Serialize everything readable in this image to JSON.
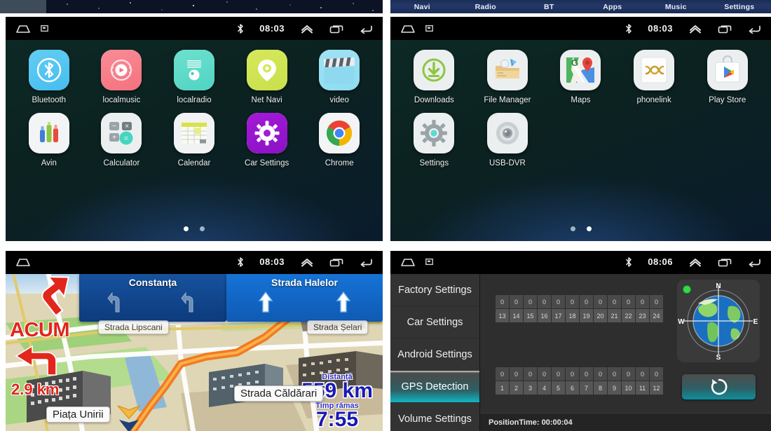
{
  "topstrip": {
    "menu": [
      "Navi",
      "Radio",
      "BT",
      "Apps",
      "Music",
      "Settings"
    ]
  },
  "statusbar": {
    "time_0803": "08:03",
    "time_0806": "08:06",
    "icons": [
      "home-icon",
      "screenshot-icon",
      "bluetooth-icon",
      "expand-up-icon",
      "recents-icon",
      "back-icon"
    ]
  },
  "apps_page1": {
    "row1": [
      {
        "label": "Bluetooth",
        "icon": "bluetooth-icon"
      },
      {
        "label": "localmusic",
        "icon": "music-player-icon"
      },
      {
        "label": "localradio",
        "icon": "radio-icon"
      },
      {
        "label": "Net Navi",
        "icon": "map-pin-icon"
      },
      {
        "label": "video",
        "icon": "clapperboard-icon"
      }
    ],
    "row2": [
      {
        "label": "Avin",
        "icon": "avin-icon"
      },
      {
        "label": "Calculator",
        "icon": "calculator-icon"
      },
      {
        "label": "Calendar",
        "icon": "calendar-icon"
      },
      {
        "label": "Car Settings",
        "icon": "gear-icon"
      },
      {
        "label": "Chrome",
        "icon": "chrome-icon"
      }
    ],
    "page_dots": {
      "count": 2,
      "active": 0
    }
  },
  "apps_page2": {
    "row1": [
      {
        "label": "Downloads",
        "icon": "download-icon"
      },
      {
        "label": "File Manager",
        "icon": "folder-icon"
      },
      {
        "label": "Maps",
        "icon": "google-maps-icon"
      },
      {
        "label": "phonelink",
        "icon": "phonelink-icon"
      },
      {
        "label": "Play Store",
        "icon": "play-store-icon"
      }
    ],
    "row2": [
      {
        "label": "Settings",
        "icon": "gear-icon"
      },
      {
        "label": "USB-DVR",
        "icon": "dvr-camera-icon"
      }
    ],
    "page_dots": {
      "count": 2,
      "active": 1
    }
  },
  "navigation": {
    "maneuver_now": "ACUM",
    "maneuver_distance": "2.9 km",
    "sign_left": {
      "title": "Constanța",
      "lanes": [
        "turn-left-arrow",
        "turn-left-arrow"
      ]
    },
    "sign_right": {
      "title": "Strada Halelor",
      "lanes": [
        "straight-arrow",
        "straight-arrow"
      ]
    },
    "street_labels": [
      {
        "text": "Piața Unirii"
      },
      {
        "text": "Strada Căldărari"
      },
      {
        "text": "Strada Lipscani"
      },
      {
        "text": "Strada Șelari"
      }
    ],
    "remaining_distance_caption": "Distanță",
    "remaining_distance_value": "559 km",
    "remaining_time_caption": "Timp rămas",
    "remaining_time_value": "7:55"
  },
  "settings": {
    "sidebar": [
      "Factory Settings",
      "Car Settings",
      "Android Settings",
      "GPS Detection",
      "Volume Settings"
    ],
    "active_index": 3,
    "gps": {
      "group_top": {
        "values": [
          0,
          0,
          0,
          0,
          0,
          0,
          0,
          0,
          0,
          0,
          0,
          0
        ],
        "ids": [
          13,
          14,
          15,
          16,
          17,
          18,
          19,
          20,
          21,
          22,
          23,
          24
        ]
      },
      "group_bottom": {
        "values": [
          0,
          0,
          0,
          0,
          0,
          0,
          0,
          0,
          0,
          0,
          0,
          0
        ],
        "ids": [
          1,
          2,
          3,
          4,
          5,
          6,
          7,
          8,
          9,
          10,
          11,
          12
        ]
      },
      "compass": {
        "n": "N",
        "e": "E",
        "s": "S",
        "w": "W"
      },
      "status_led": "#2fdc4a",
      "refresh_icon": "refresh-icon",
      "position_time": "PositionTime: 00:00:04"
    }
  },
  "colors": {
    "accent_teal": "#0fb7c4",
    "sign_blue": "#1673d6",
    "alert_red": "#e2261c",
    "eta_blue": "#1a1ab4"
  }
}
